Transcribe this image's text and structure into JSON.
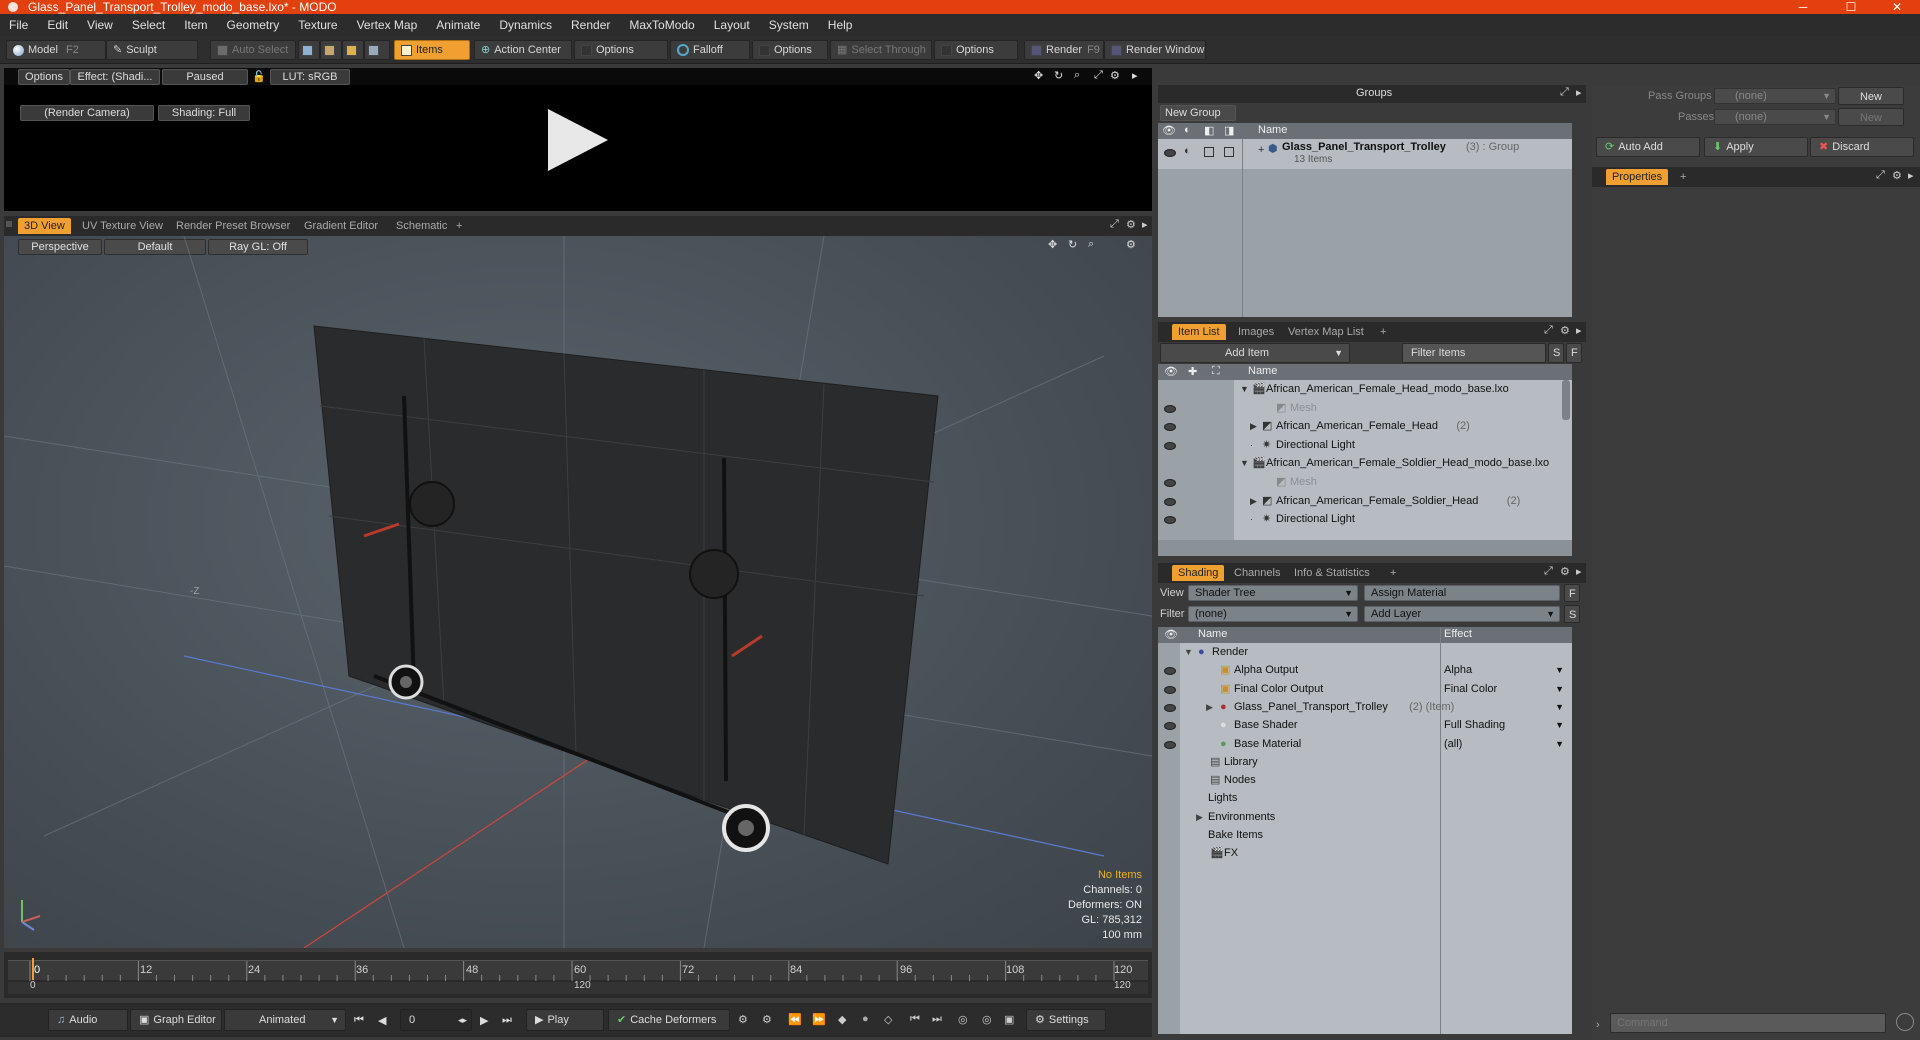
{
  "window": {
    "title": "Glass_Panel_Transport_Trolley_modo_base.lxo* - MODO",
    "minimize": "─",
    "maximize": "☐",
    "close": "✕"
  },
  "menu": [
    "File",
    "Edit",
    "View",
    "Select",
    "Item",
    "Geometry",
    "Texture",
    "Vertex Map",
    "Animate",
    "Dynamics",
    "Render",
    "MaxToModo",
    "Layout",
    "System",
    "Help"
  ],
  "toolbar": {
    "model": "Model",
    "model_key": "F2",
    "sculpt": "Sculpt",
    "auto_select": "Auto Select",
    "items": "Items",
    "action_center": "Action Center",
    "options1": "Options",
    "falloff": "Falloff",
    "options2": "Options",
    "select_through": "Select Through",
    "options3": "Options",
    "render": "Render",
    "render_key": "F9",
    "render_window": "Render Window"
  },
  "preview": {
    "options": "Options",
    "effect": "Effect: (Shadi...",
    "paused": "Paused",
    "lut": "LUT: sRGB",
    "camera": "(Render Camera)",
    "shading": "Shading: Full"
  },
  "viewport_tabs": [
    "3D View",
    "UV Texture View",
    "Render Preset Browser",
    "Gradient Editor",
    "Schematic",
    "+"
  ],
  "viewport": {
    "perspective": "Perspective",
    "default": "Default",
    "raygl": "Ray GL: Off",
    "axis_label": "-Z",
    "info": {
      "items": "No Items",
      "channels": "Channels: 0",
      "deformers": "Deformers: ON",
      "gl": "GL: 785,312",
      "unit": "100 mm"
    }
  },
  "timeline": {
    "ticks": [
      "0",
      "12",
      "24",
      "36",
      "48",
      "60",
      "72",
      "84",
      "96",
      "108",
      "120"
    ],
    "lower_left": "0",
    "lower_mid": "120",
    "lower_right": "120"
  },
  "bottombar": {
    "audio": "Audio",
    "graph_editor": "Graph Editor",
    "animated": "Animated",
    "frame": "0",
    "play": "Play",
    "cache_deformers": "Cache Deformers",
    "settings": "Settings"
  },
  "groups": {
    "header": "Groups",
    "new_group": "New Group",
    "col_name": "Name",
    "item_name": "Glass_Panel_Transport_Trolley",
    "item_suffix": "(3) : Group",
    "item_count": "13 Items"
  },
  "passes": {
    "pass_groups_label": "Pass Groups",
    "pass_groups_value": "(none)",
    "new1": "New",
    "passes_label": "Passes",
    "passes_value": "(none)",
    "new2": "New",
    "auto_add": "Auto Add",
    "apply": "Apply",
    "discard": "Discard",
    "properties_tab": "Properties",
    "plus": "+"
  },
  "itemlist": {
    "tabs": [
      "Item List",
      "Images",
      "Vertex Map List",
      "+"
    ],
    "add_item": "Add Item",
    "filter_items": "Filter Items",
    "s": "S",
    "f": "F",
    "col_name": "Name",
    "rows": [
      {
        "label": "African_American_Female_Head_modo_base.lxo",
        "indent": 0,
        "suffix": ""
      },
      {
        "label": "Mesh",
        "indent": 2,
        "suffix": "",
        "dim": true
      },
      {
        "label": "African_American_Female_Head",
        "indent": 1,
        "suffix": "(2)"
      },
      {
        "label": "Directional Light",
        "indent": 1,
        "suffix": ""
      },
      {
        "label": "African_American_Female_Soldier_Head_modo_base.lxo",
        "indent": 0,
        "suffix": ""
      },
      {
        "label": "Mesh",
        "indent": 2,
        "suffix": "",
        "dim": true
      },
      {
        "label": "African_American_Female_Soldier_Head",
        "indent": 1,
        "suffix": "(2)"
      },
      {
        "label": "Directional Light",
        "indent": 1,
        "suffix": ""
      }
    ]
  },
  "shading": {
    "tabs": [
      "Shading",
      "Channels",
      "Info & Statistics",
      "+"
    ],
    "view_label": "View",
    "view_value": "Shader Tree",
    "assign_material": "Assign Material",
    "f": "F",
    "filter_label": "Filter",
    "filter_value": "(none)",
    "add_layer": "Add Layer",
    "s": "S",
    "col_name": "Name",
    "col_effect": "Effect",
    "rows": [
      {
        "name": "Render",
        "suffix": "",
        "effect": ""
      },
      {
        "name": "Alpha Output",
        "suffix": "",
        "effect": "Alpha"
      },
      {
        "name": "Final Color Output",
        "suffix": "",
        "effect": "Final Color"
      },
      {
        "name": "Glass_Panel_Transport_Trolley",
        "suffix": "(2) (Item)",
        "effect": ""
      },
      {
        "name": "Base Shader",
        "suffix": "",
        "effect": "Full Shading"
      },
      {
        "name": "Base Material",
        "suffix": "",
        "effect": "(all)"
      },
      {
        "name": "Library",
        "suffix": "",
        "effect": ""
      },
      {
        "name": "Nodes",
        "suffix": "",
        "effect": ""
      },
      {
        "name": "Lights",
        "suffix": "",
        "effect": ""
      },
      {
        "name": "Environments",
        "suffix": "",
        "effect": ""
      },
      {
        "name": "Bake Items",
        "suffix": "",
        "effect": ""
      },
      {
        "name": "FX",
        "suffix": "",
        "effect": ""
      }
    ]
  },
  "command": {
    "placeholder": "Command"
  },
  "colors": {
    "accent": "#f0a030",
    "titlebar": "#e2410f"
  }
}
